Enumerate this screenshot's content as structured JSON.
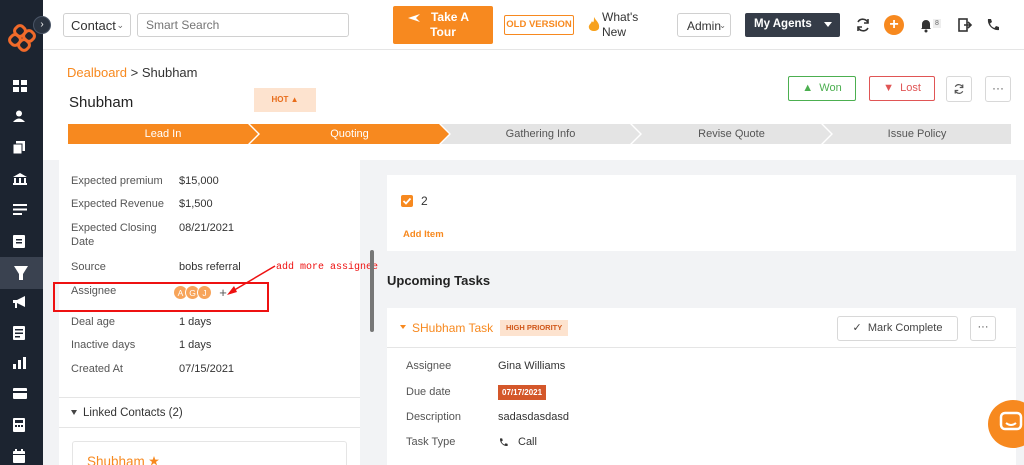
{
  "header": {
    "contact_select": "Contact",
    "search_placeholder": "Smart Search",
    "tour_label_1": "Take A",
    "tour_label_2": "Tour",
    "old_version": "OLD VERSION",
    "whats_new_1": "What's",
    "whats_new_2": "New",
    "admin_select": "Admin",
    "agents_label": "My Agents",
    "notif_count": "8"
  },
  "deal": {
    "breadcrumb_link": "Dealboard",
    "breadcrumb_sep": ">",
    "breadcrumb_current": "Shubham",
    "title": "Shubham",
    "hot_label": "HOT",
    "won_label": "Won",
    "lost_label": "Lost",
    "more_label": "···"
  },
  "pipeline": [
    {
      "label": "Lead In",
      "active": true
    },
    {
      "label": "Quoting",
      "active": true
    },
    {
      "label": "Gathering Info",
      "active": false
    },
    {
      "label": "Revise Quote",
      "active": false
    },
    {
      "label": "Issue Policy",
      "active": false
    }
  ],
  "details": {
    "expected_premium_label": "Expected premium",
    "expected_premium": "$15,000",
    "expected_revenue_label": "Expected Revenue",
    "expected_revenue": "$1,500",
    "closing_label_1": "Expected Closing",
    "closing_label_2": "Date",
    "closing_date": "08/21/2021",
    "source_label": "Source",
    "source": "bobs referral",
    "assignee_label": "Assignee",
    "assignee_avatars": [
      "A",
      "G",
      "J"
    ],
    "add_assignee": "+",
    "deal_age_label": "Deal age",
    "deal_age": "1 days",
    "inactive_label": "Inactive days",
    "inactive": "1 days",
    "created_label": "Created At",
    "created": "07/15/2021",
    "linked_contacts": "Linked Contacts (2)",
    "contact_name": "Shubham"
  },
  "annotation": {
    "text": "add more assignee"
  },
  "checklist": {
    "item_label": "2",
    "add_item": "Add Item"
  },
  "tasks": {
    "heading": "Upcoming Tasks",
    "title": "SHubham Task",
    "priority": "HIGH PRIORITY",
    "mark_complete": "Mark Complete",
    "more": "···",
    "assignee_label": "Assignee",
    "assignee": "Gina Williams",
    "due_label": "Due date",
    "due": "07/17/2021",
    "desc_label": "Description",
    "desc": "sadasdasdasd",
    "type_label": "Task Type",
    "type": "Call"
  },
  "colors": {
    "accent": "#f7891f",
    "sidebar": "#1c2430",
    "won": "#4caf50",
    "lost": "#e05555",
    "annotation": "#ee1111"
  },
  "icons": [
    "logo-icon",
    "dashboard-icon",
    "contacts-icon",
    "documents-icon",
    "bank-icon",
    "list-icon",
    "clipboard-icon",
    "funnel-icon",
    "megaphone-icon",
    "report-icon",
    "chart-icon",
    "card-icon",
    "calculator-icon",
    "calendar-icon",
    "refresh-icon",
    "bell-icon",
    "logout-icon",
    "phone-icon",
    "chat-icon"
  ]
}
